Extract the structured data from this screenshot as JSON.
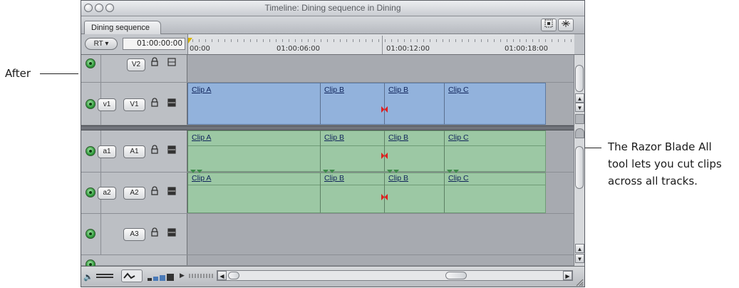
{
  "annotations": {
    "after_label": "After",
    "razor_note": [
      "The Razor Blade All",
      "tool lets you cut clips",
      "across all tracks."
    ]
  },
  "window": {
    "title": "Timeline: Dining sequence in Dining",
    "tab": "Dining sequence"
  },
  "header": {
    "rt_label": "RT ▾",
    "timecode": "01:00:00:00",
    "ruler_labels": [
      "00:00",
      "01:00:06:00",
      "01:00:12:00",
      "01:00:18:00"
    ]
  },
  "tracks": [
    {
      "key": "V2",
      "dest": "",
      "label": "V2",
      "kind": "video"
    },
    {
      "key": "V1",
      "dest": "v1",
      "label": "V1",
      "kind": "video"
    },
    {
      "key": "A1",
      "dest": "a1",
      "label": "A1",
      "kind": "audio"
    },
    {
      "key": "A2",
      "dest": "a2",
      "label": "A2",
      "kind": "audio"
    },
    {
      "key": "A3",
      "dest": "",
      "label": "A3",
      "kind": "audio"
    }
  ],
  "clips": {
    "v1": [
      "Clip A",
      "Clip B",
      "Clip B",
      "Clip C"
    ],
    "a1": [
      "Clip A",
      "Clip B",
      "Clip B",
      "Clip C"
    ],
    "a2": [
      "Clip A",
      "Clip B",
      "Clip B",
      "Clip C"
    ]
  },
  "colors": {
    "video_clip": "#92b2dc",
    "audio_clip": "#9cc8a4",
    "cut_marker": "#e02020",
    "track_enable": "#2e9a3a"
  },
  "icons": {
    "lock": "lock-icon",
    "auto_select": "auto-select-icon",
    "track_enable": "track-visibility-icon",
    "speaker": "speaker-icon"
  }
}
